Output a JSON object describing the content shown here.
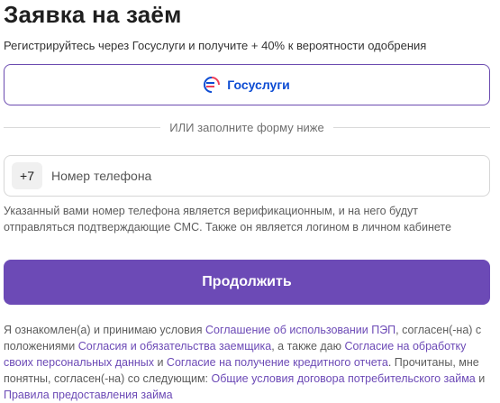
{
  "page": {
    "title": "Заявка на заём",
    "subtitle": "Регистрируйтесь через Госуслуги и получите + 40% к вероятности одобрения"
  },
  "gosuslugi_button": {
    "label": "Госуслуги",
    "logo_icon": "gosuslugi-logo-icon",
    "brand_color": "#0d4cd3"
  },
  "divider": {
    "text": "ИЛИ заполните форму ниже"
  },
  "phone": {
    "prefix": "+7",
    "value": "",
    "placeholder": "Номер телефона"
  },
  "hint": {
    "text": "Указанный вами номер телефона является верификационным, и на него будут отправляться подтверждающие СМС. Также он является логином в личном кабинете"
  },
  "submit": {
    "label": "Продолжить",
    "color": "#6c4ab6"
  },
  "legal": {
    "t1": "Я ознакомлен(а) и принимаю условия ",
    "link1": "Соглашение об использовании ПЭП",
    "t2": ", согласен(-на) с положениями ",
    "link2": "Согласия и обязательства заемщика",
    "t3": ", а также даю ",
    "link3": "Согласие на обработку своих персональных данных",
    "t4": " и ",
    "link4": "Согласие на получение кредитного отчета",
    "t5": ". Прочитаны, мне понятны, согласен(-на) со следующим: ",
    "link5": "Общие условия договора потребительского займа",
    "t6": " и ",
    "link6": "Правила предоставления займа",
    "link_color": "#6c4ab6"
  }
}
